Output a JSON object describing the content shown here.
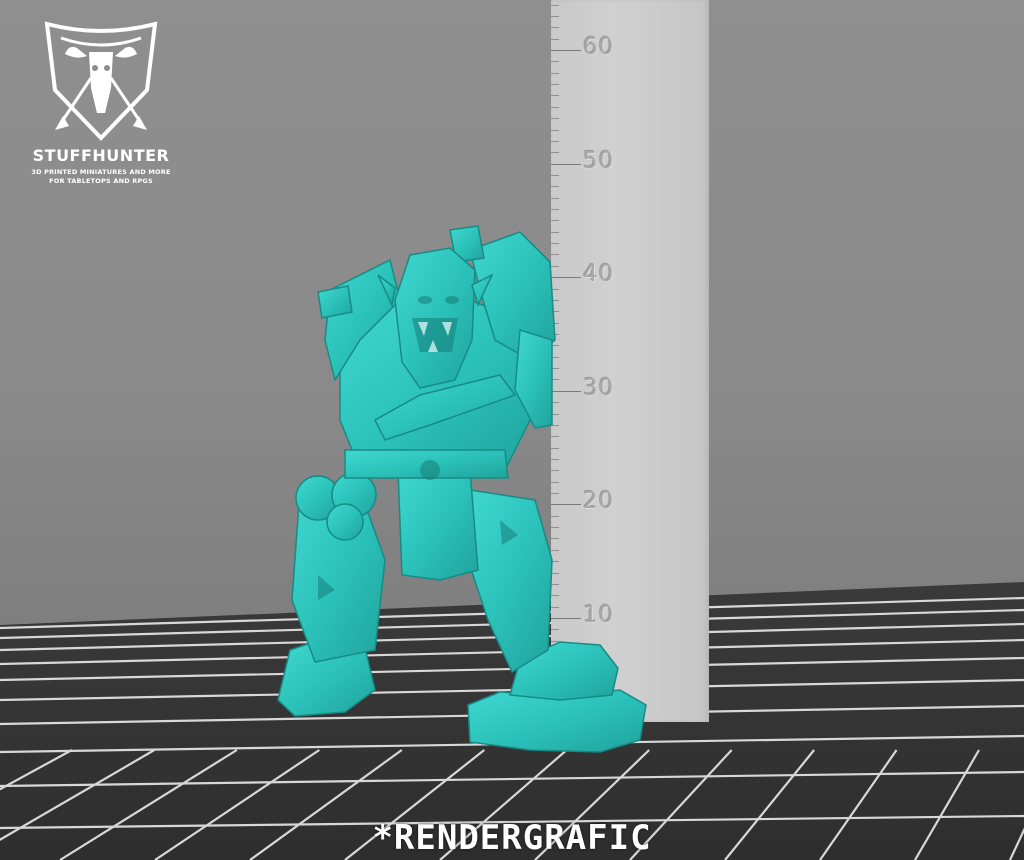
{
  "logo": {
    "name": "STUFFHUNTER",
    "tagline_line1": "3D PRINTED MINIATURES AND MORE",
    "tagline_line2": "FOR TABLETOPS AND RPGS"
  },
  "ruler": {
    "labels": [
      "60",
      "50",
      "40",
      "30",
      "20",
      "10"
    ]
  },
  "caption": "*RENDERGRAFIC",
  "colors": {
    "model": "#2ec4bc",
    "ruler": "#cccccc",
    "background": "#8c8c8c",
    "grid": "#dddddd"
  }
}
